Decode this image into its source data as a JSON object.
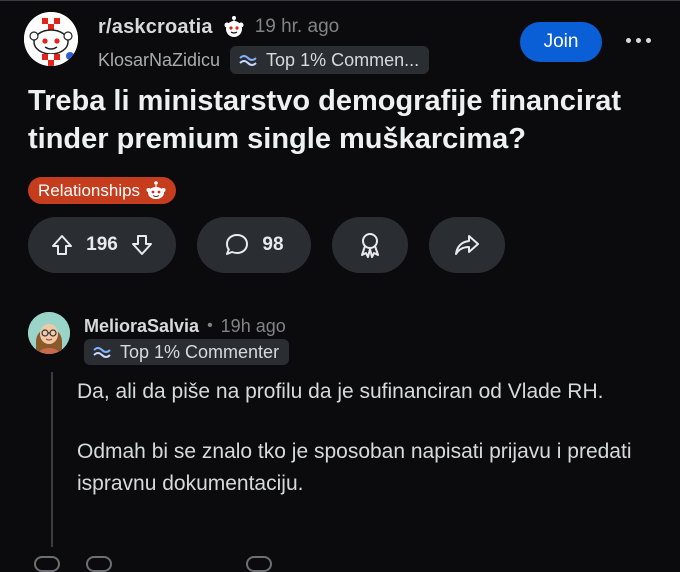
{
  "post": {
    "subreddit": "r/askcroatia",
    "time": "19 hr. ago",
    "author": "KlosarNaZidicu",
    "author_flair": "Top 1% Commen...",
    "join_label": "Join",
    "title": "Treba li ministarstvo demografije financirat tinder premium single muškarcima?",
    "tag": "Relationships",
    "votes": "196",
    "comments": "98"
  },
  "comment": {
    "author": "MelioraSalvia",
    "separator": "•",
    "time": "19h ago",
    "flair": "Top 1% Commenter",
    "paragraphs": [
      "Da, ali da piše na profilu da je sufinanciran od Vlade RH.",
      "Odmah bi se znalo tko je sposoban napisati prijavu i predati ispravnu dokumentaciju."
    ]
  },
  "colors": {
    "background": "#0b0b0d",
    "join_button": "#0a5fd6",
    "tag_background": "#c63d1e",
    "pill_background": "#2a2d32"
  },
  "icons": [
    "subreddit-snoo-icon",
    "snoo-badge-icon",
    "wave-flair-icon",
    "more-dots-icon",
    "upvote-icon",
    "downvote-icon",
    "comment-icon",
    "award-icon",
    "share-icon"
  ]
}
